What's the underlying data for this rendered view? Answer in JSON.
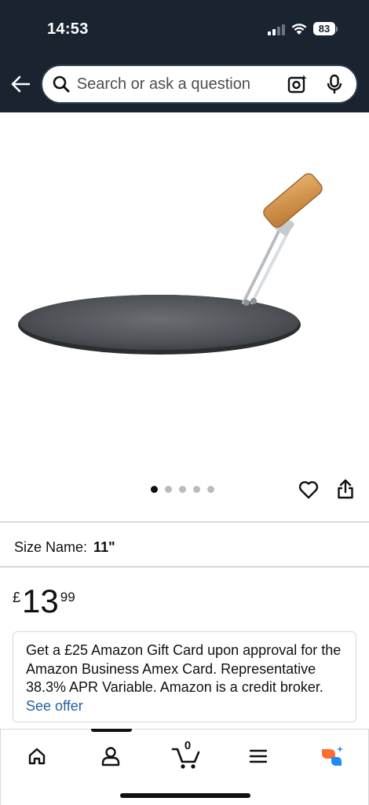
{
  "status_bar": {
    "time": "14:53",
    "battery": "83"
  },
  "header": {
    "back_icon": "arrow-left-icon",
    "search_placeholder": "Search or ask a question",
    "lens_icon": "camera-lens-icon",
    "mic_icon": "microphone-icon"
  },
  "gallery": {
    "image_description_icon": "tawa-pan-product-image",
    "image_count": 5,
    "active_index": 0
  },
  "product": {
    "size_label": "Size Name:",
    "size_value": "11\"",
    "price_symbol": "£",
    "price_whole": "13",
    "price_fraction": "99"
  },
  "offer": {
    "text": "Get a £25 Amazon Gift Card upon approval for the Amazon Business Amex Card. Representative 38.3% APR Variable. Amazon is a credit broker.",
    "link": "See offer"
  },
  "bottom_nav": {
    "cart_count": "0",
    "items": [
      "home-icon",
      "account-icon",
      "cart-icon",
      "menu-icon",
      "rufus-icon"
    ]
  },
  "colors": {
    "header_bg": "#1a2330",
    "link": "#2162a1",
    "rufus_orange": "#ff6d2f",
    "rufus_blue": "#1f8cf5"
  }
}
